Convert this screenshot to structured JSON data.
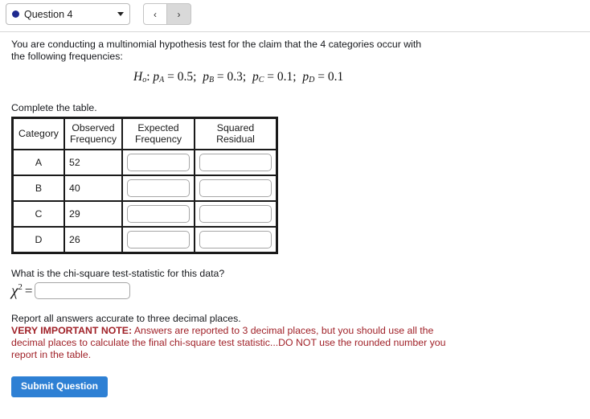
{
  "header": {
    "question_label": "Question 4",
    "status_dot_color": "#1f2a8f",
    "prev_label": "‹",
    "next_label": "›"
  },
  "question": {
    "prompt": "You are conducting a multinomial hypothesis test for the claim that the 4 categories occur with the following frequencies:",
    "hypothesis": {
      "symbol": "H",
      "subscript": "o",
      "colon": ":",
      "terms": [
        {
          "p": "p",
          "sub": "A",
          "eq": "=",
          "value": "0.5;"
        },
        {
          "p": "p",
          "sub": "B",
          "eq": "=",
          "value": "0.3;"
        },
        {
          "p": "p",
          "sub": "C",
          "eq": "=",
          "value": "0.1;"
        },
        {
          "p": "p",
          "sub": "D",
          "eq": "=",
          "value": "0.1"
        }
      ]
    },
    "complete_table_label": "Complete the table."
  },
  "table": {
    "headers": [
      "Category",
      "Observed Frequency",
      "Expected Frequency",
      "Squared Residual"
    ],
    "header_lines": [
      [
        "Category"
      ],
      [
        "Observed",
        "Frequency"
      ],
      [
        "Expected",
        "Frequency"
      ],
      [
        "Squared",
        "Residual"
      ]
    ],
    "rows": [
      {
        "category": "A",
        "observed": "52",
        "expected": "",
        "squared_residual": ""
      },
      {
        "category": "B",
        "observed": "40",
        "expected": "",
        "squared_residual": ""
      },
      {
        "category": "C",
        "observed": "29",
        "expected": "",
        "squared_residual": ""
      },
      {
        "category": "D",
        "observed": "26",
        "expected": "",
        "squared_residual": ""
      }
    ]
  },
  "chi_square": {
    "question": "What is the chi-square test-statistic for this data?",
    "symbol": "χ",
    "exponent": "2",
    "equals": "=",
    "value": ""
  },
  "notes": {
    "plain": "Report all answers accurate to three decimal places.",
    "red_bold": "VERY IMPORTANT NOTE:",
    "red_rest": " Answers are reported to 3 decimal places, but you should use all the decimal places to calculate the final chi-square test statistic...DO NOT use the rounded number you report in the table.",
    "red_color": "#a02128"
  },
  "submit": {
    "label": "Submit Question",
    "color": "#2e80d4"
  }
}
